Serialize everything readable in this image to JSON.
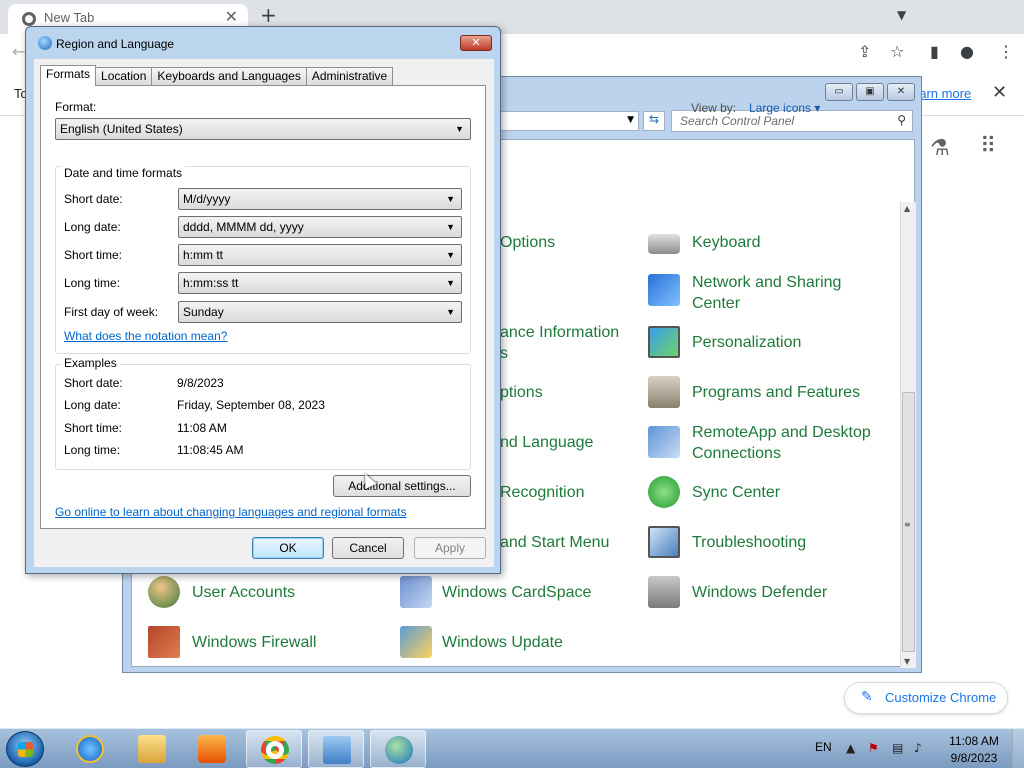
{
  "browser": {
    "tab_title": "New Tab",
    "infobar_left": "To",
    "infobar_link": "earn more",
    "customize_label": "Customize Chrome"
  },
  "control_panel": {
    "search_placeholder": "Search Control Panel",
    "view_by_label": "View by:",
    "view_by_value": "Large icons",
    "items": [
      {
        "line1": "Options",
        "line2": "",
        "icon": "options-icon"
      },
      {
        "line1": "ance Information",
        "line2": "s",
        "icon": "performance-icon"
      },
      {
        "line1": "ptions",
        "line2": "",
        "icon": "power-options-icon"
      },
      {
        "line1": "nd Language",
        "line2": "",
        "icon": "region-language-icon"
      },
      {
        "line1": "Recognition",
        "line2": "",
        "icon": "speech-recognition-icon"
      },
      {
        "line1": "and Start Menu",
        "line2": "",
        "icon": "taskbar-start-menu-icon"
      },
      {
        "line1": "Keyboard",
        "line2": "",
        "icon": "keyboard-icon"
      },
      {
        "line1": "Network and Sharing",
        "line2": "Center",
        "icon": "network-sharing-icon"
      },
      {
        "line1": "Personalization",
        "line2": "",
        "icon": "personalization-icon"
      },
      {
        "line1": "Programs and Features",
        "line2": "",
        "icon": "programs-features-icon"
      },
      {
        "line1": "RemoteApp and Desktop",
        "line2": "Connections",
        "icon": "remoteapp-icon"
      },
      {
        "line1": "Sync Center",
        "line2": "",
        "icon": "sync-center-icon"
      },
      {
        "line1": "Troubleshooting",
        "line2": "",
        "icon": "troubleshooting-icon"
      },
      {
        "line1": "User Accounts",
        "line2": "",
        "icon": "user-accounts-icon"
      },
      {
        "line1": "Windows CardSpace",
        "line2": "",
        "icon": "cardspace-icon"
      },
      {
        "line1": "Windows Defender",
        "line2": "",
        "icon": "defender-icon"
      },
      {
        "line1": "Windows Firewall",
        "line2": "",
        "icon": "firewall-icon"
      },
      {
        "line1": "Windows Update",
        "line2": "",
        "icon": "windows-update-icon"
      }
    ]
  },
  "dialog": {
    "title": "Region and Language",
    "tabs": [
      "Formats",
      "Location",
      "Keyboards and Languages",
      "Administrative"
    ],
    "active_tab": "Formats",
    "format_label": "Format:",
    "format_value": "English (United States)",
    "date_time_group": "Date and time formats",
    "fields": [
      {
        "label": "Short date:",
        "value": "M/d/yyyy"
      },
      {
        "label": "Long date:",
        "value": "dddd, MMMM dd, yyyy"
      },
      {
        "label": "Short time:",
        "value": "h:mm tt"
      },
      {
        "label": "Long time:",
        "value": "h:mm:ss tt"
      },
      {
        "label": "First day of week:",
        "value": "Sunday"
      }
    ],
    "notation_link": "What does the notation mean?",
    "examples_group": "Examples",
    "examples": [
      {
        "label": "Short date:",
        "value": "9/8/2023"
      },
      {
        "label": "Long date:",
        "value": "Friday, September 08, 2023"
      },
      {
        "label": "Short time:",
        "value": "11:08 AM"
      },
      {
        "label": "Long time:",
        "value": "11:08:45 AM"
      }
    ],
    "additional_settings": "Additional settings...",
    "online_link": "Go online to learn about changing languages and regional formats",
    "ok": "OK",
    "cancel": "Cancel",
    "apply": "Apply"
  },
  "taskbar": {
    "language": "EN",
    "time": "11:08 AM",
    "date": "9/8/2023"
  },
  "colors": {
    "cp_link_green": "#1e7a3a",
    "dialog_link_blue": "#0066cc",
    "chrome_blue": "#1a73e8"
  }
}
